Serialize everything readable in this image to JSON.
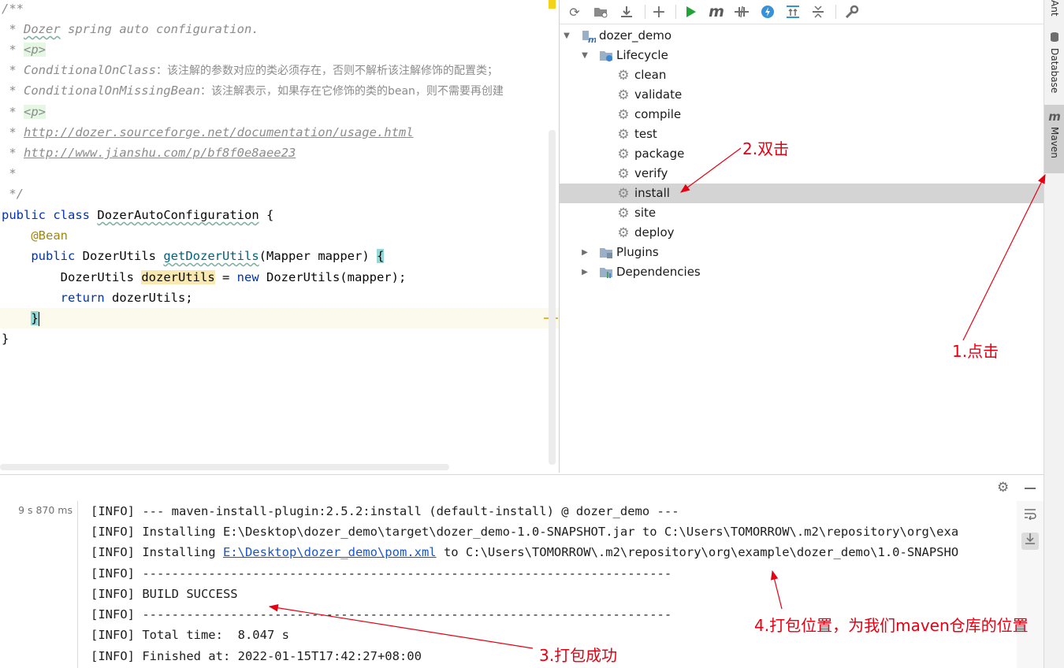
{
  "editor": {
    "comment": {
      "open": "/**",
      "line_title_star": " * ",
      "line_title_word": "Dozer",
      "line_title_rest": " spring auto configuration.",
      "p_tag": "<p>",
      "cond_class_name": "ConditionalOnClass",
      "cond_class_desc": "：该注解的参数对应的类必须存在，否则不解析该注解修饰的配置类；",
      "cond_missing_name": "ConditionalOnMissingBean",
      "cond_missing_desc": "：该注解表示，如果存在它修饰的类的bean，则不需要再创建",
      "link1": "http://dozer.sourceforge.net/documentation/usage.html",
      "link2": "http://www.jianshu.com/p/bf8f0e8aee23",
      "star": " *",
      "close": " */"
    },
    "code": {
      "kw_public": "public",
      "kw_class": "class",
      "class_name": "DozerAutoConfiguration",
      "open_brace": " {",
      "annotation": "@Bean",
      "return_type": "DozerUtils",
      "method_name": "getDozerUtils",
      "params": "(Mapper mapper) ",
      "brace": "{",
      "local_type": "DozerUtils",
      "local_var": "dozerUtils",
      "assign": " = ",
      "kw_new": "new",
      "ctor_call": " DozerUtils(mapper);",
      "kw_return": "return",
      "return_expr": " dozerUtils;",
      "close_method": "}",
      "close_class": "}"
    }
  },
  "maven": {
    "toolbar": [
      "reload-icon",
      "generate-sources-icon",
      "download-icon",
      "add-icon",
      "run-icon",
      "maven-goal-icon",
      "toggle-offline-icon",
      "skip-tests-icon",
      "show-dependencies-icon",
      "collapse-all-icon",
      "settings-wrench-icon"
    ],
    "project": "dozer_demo",
    "lifecycle_label": "Lifecycle",
    "lifecycle_items": [
      "clean",
      "validate",
      "compile",
      "test",
      "package",
      "verify",
      "install",
      "site",
      "deploy"
    ],
    "selected_item": "install",
    "plugins_label": "Plugins",
    "dependencies_label": "Dependencies"
  },
  "side_tabs": {
    "ant": "Ant",
    "database": "Database",
    "maven": "Maven"
  },
  "console": {
    "elapsed": "9 s 870 ms",
    "lines": [
      "[INFO] --- maven-install-plugin:2.5.2:install (default-install) @ dozer_demo ---",
      "[INFO] Installing E:\\Desktop\\dozer_demo\\target\\dozer_demo-1.0-SNAPSHOT.jar to C:\\Users\\TOMORROW\\.m2\\repository\\org\\exa",
      "",
      "[INFO] ------------------------------------------------------------------------",
      "[INFO] BUILD SUCCESS",
      "[INFO] ------------------------------------------------------------------------",
      "[INFO] Total time:  8.047 s",
      "[INFO] Finished at: 2022-01-15T17:42:27+08:00"
    ],
    "line3_prefix": "[INFO] Installing ",
    "line3_link": "E:\\Desktop\\dozer_demo\\pom.xml",
    "line3_suffix": " to C:\\Users\\TOMORROW\\.m2\\repository\\org\\example\\dozer_demo\\1.0-SNAPSHO"
  },
  "annotations": {
    "step1": "1.点击",
    "step2": "2.双击",
    "step3": "3.打包成功",
    "step4": "4.打包位置，为我们maven仓库的位置"
  },
  "colors": {
    "annotation_red": "#e60012",
    "selection_gray": "#d4d4d4",
    "keyword_blue": "#0033b3",
    "comment_gray": "#8c8c8c"
  }
}
